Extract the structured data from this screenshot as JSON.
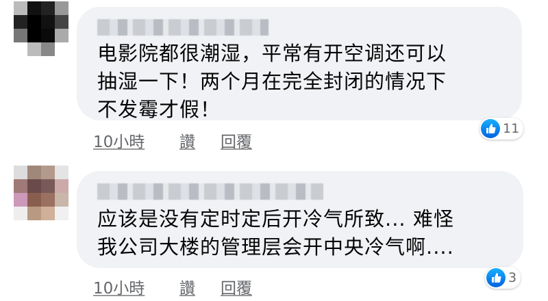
{
  "comments": [
    {
      "text_lines": [
        "电影院都很潮湿，平常有开空调还可以",
        "抽湿一下！两个月在完全封闭的情况下",
        "不发霉才假！"
      ],
      "time": "10小時",
      "like_label": "讚",
      "reply_label": "回覆",
      "reaction_count": "11",
      "reaction_icon": "thumbs-up-icon"
    },
    {
      "text_lines": [
        "应该是没有定时定后开冷气所致... 难怪",
        "我公司大楼的管理层会开中央冷气啊...."
      ],
      "time": "10小時",
      "like_label": "讚",
      "reply_label": "回覆",
      "reaction_count": "3",
      "reaction_icon": "thumbs-up-icon"
    }
  ],
  "colors": {
    "bubble": "#f0f2f5",
    "like_blue": "#1877f2",
    "meta_text": "#65676b"
  }
}
